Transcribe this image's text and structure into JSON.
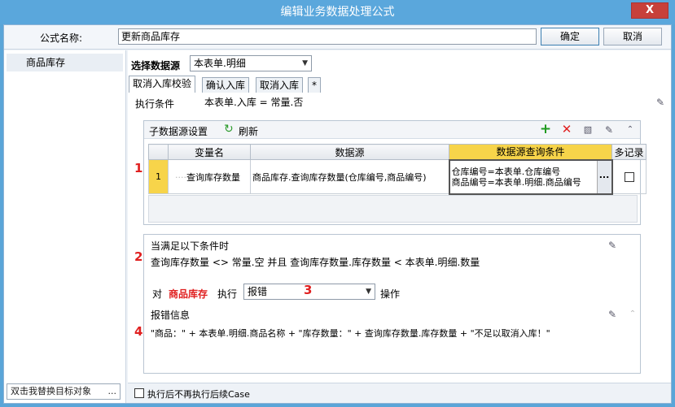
{
  "window": {
    "title": "编辑业务数据处理公式",
    "close_label": "X"
  },
  "header": {
    "name_label": "公式名称:",
    "name_value": "更新商品库存",
    "ok_label": "确定",
    "cancel_label": "取消"
  },
  "sidebar": {
    "items": [
      {
        "label": "商品库存"
      }
    ],
    "bottom_text": "双击我替换目标对象",
    "bottom_more": "..."
  },
  "datasource": {
    "label": "选择数据源",
    "value": "本表单.明细"
  },
  "tabs": [
    {
      "label": "取消入库校验",
      "active": true
    },
    {
      "label": "确认入库",
      "active": false
    },
    {
      "label": "取消入库",
      "active": false
    },
    {
      "label": "*",
      "active": false
    }
  ],
  "condition": {
    "label": "执行条件",
    "value": "本表单.入库 = 常量.否"
  },
  "subsource": {
    "title": "子数据源设置",
    "refresh_label": "刷新",
    "columns": [
      "变量名",
      "数据源",
      "数据源查询条件",
      "多记录"
    ],
    "rows": [
      {
        "index": "1",
        "var_name": "查询库存数量",
        "source": "商品库存.查询库存数量(仓库编号,商品编号)",
        "query_line1": "仓库编号=本表单.仓库编号",
        "query_line2": "商品编号=本表单.明细.商品编号",
        "ellipsis": "...",
        "multi": false
      }
    ]
  },
  "rule": {
    "when_label": "当满足以下条件时",
    "expression": "查询库存数量 <> 常量.空 并且 查询库存数量.库存数量 < 本表单.明细.数量",
    "for_label": "对",
    "target": "商品库存",
    "exec_label": "执行",
    "action": "报错",
    "op_label": "操作",
    "error_label": "报错信息",
    "error_text": "\"商品：\" + 本表单.明细.商品名称 + \"库存数量：\" + 查询库存数量.库存数量 + \"不足以取消入库！\""
  },
  "markers": {
    "m1": "1",
    "m2": "2",
    "m3": "3",
    "m4": "4"
  },
  "footer": {
    "no_more_label": "执行后不再执行后续Case"
  },
  "colors": {
    "accent": "#5aa7dc",
    "highlight": "#f7d44a",
    "marker": "#e02020"
  }
}
